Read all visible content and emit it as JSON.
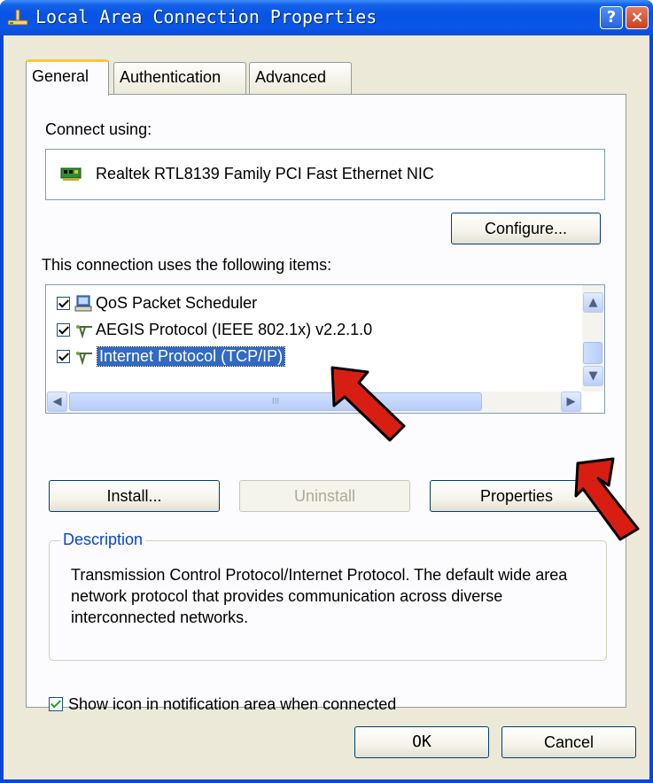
{
  "window": {
    "title": "Local Area Connection Properties",
    "help_label": "?",
    "close_label": "×"
  },
  "tabs": [
    {
      "label": "General",
      "active": true
    },
    {
      "label": "Authentication",
      "active": false
    },
    {
      "label": "Advanced",
      "active": false
    }
  ],
  "general": {
    "connect_using_label": "Connect using:",
    "adapter_name": "Realtek RTL8139 Family PCI Fast Ethernet NIC",
    "configure_label": "Configure...",
    "items_label": "This connection uses the following items:",
    "items": [
      {
        "label": "QoS Packet Scheduler",
        "checked": true,
        "icon": "qos-scheduler-icon"
      },
      {
        "label": "AEGIS Protocol (IEEE 802.1x) v2.2.1.0",
        "checked": true,
        "icon": "network-protocol-icon"
      },
      {
        "label": "Internet Protocol (TCP/IP)",
        "checked": true,
        "selected": true,
        "icon": "network-protocol-icon"
      }
    ],
    "scroll_grip": "III",
    "install_label": "Install...",
    "uninstall_label": "Uninstall",
    "properties_label": "Properties",
    "description_title": "Description",
    "description_text": "Transmission Control Protocol/Internet Protocol. The default wide area network protocol that provides communication across diverse interconnected networks.",
    "show_icon_label": "Show icon in notification area when connected",
    "show_icon_checked": true
  },
  "footer": {
    "ok_label": "OK",
    "cancel_label": "Cancel"
  },
  "colors": {
    "titlebar": "#0a56e6",
    "selection": "#316ac5",
    "annotation_arrow": "#d81e12",
    "group_title": "#0046d5"
  }
}
